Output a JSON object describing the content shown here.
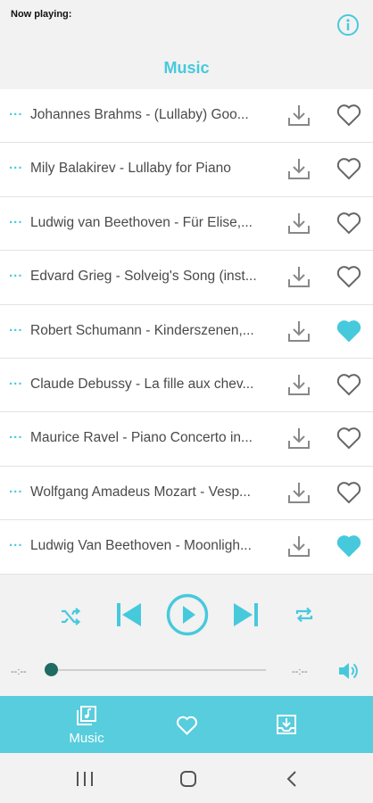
{
  "header": {
    "now_playing_label": "Now playing:",
    "title": "Music",
    "info_icon": "info-icon"
  },
  "songs": [
    {
      "title": "Johannes Brahms - (Lullaby) Goo...",
      "favorite": false
    },
    {
      "title": "Mily Balakirev - Lullaby for Piano",
      "favorite": false
    },
    {
      "title": "Ludwig van Beethoven - Für Elise,...",
      "favorite": false
    },
    {
      "title": "Edvard Grieg - Solveig's Song (inst...",
      "favorite": false
    },
    {
      "title": "Robert Schumann - Kinderszenen,...",
      "favorite": true
    },
    {
      "title": "Claude Debussy - La fille aux chev...",
      "favorite": false
    },
    {
      "title": "Maurice Ravel - Piano Concerto in...",
      "favorite": false
    },
    {
      "title": "Wolfgang Amadeus Mozart - Vesp...",
      "favorite": false
    },
    {
      "title": "Ludwig Van Beethoven - Moonligh...",
      "favorite": true
    }
  ],
  "row_prefix": "...",
  "player": {
    "elapsed": "--:--",
    "duration": "--:--",
    "progress": 0
  },
  "bottom_nav": {
    "music_label": "Music"
  },
  "colors": {
    "accent": "#47c9dc",
    "nav_bg": "#57cddd",
    "seek_thumb": "#1f6b63"
  }
}
